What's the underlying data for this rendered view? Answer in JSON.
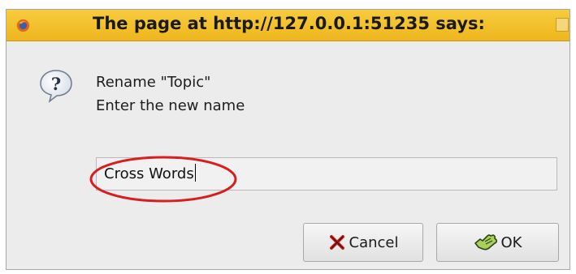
{
  "window": {
    "title": "The page at http://127.0.0.1:51235 says:"
  },
  "icons": {
    "app": "firefox-icon",
    "dialog": "question-icon",
    "cancel": "cancel-x-icon",
    "ok": "ok-hand-icon"
  },
  "colors": {
    "titlebar": "#f2c12f",
    "annotation": "#d81e1e"
  },
  "dialog": {
    "message_line1": "Rename \"Topic\"",
    "message_line2": "Enter the new name"
  },
  "input": {
    "value": "Cross Words"
  },
  "buttons": {
    "cancel_label": "Cancel",
    "ok_label": "OK"
  }
}
